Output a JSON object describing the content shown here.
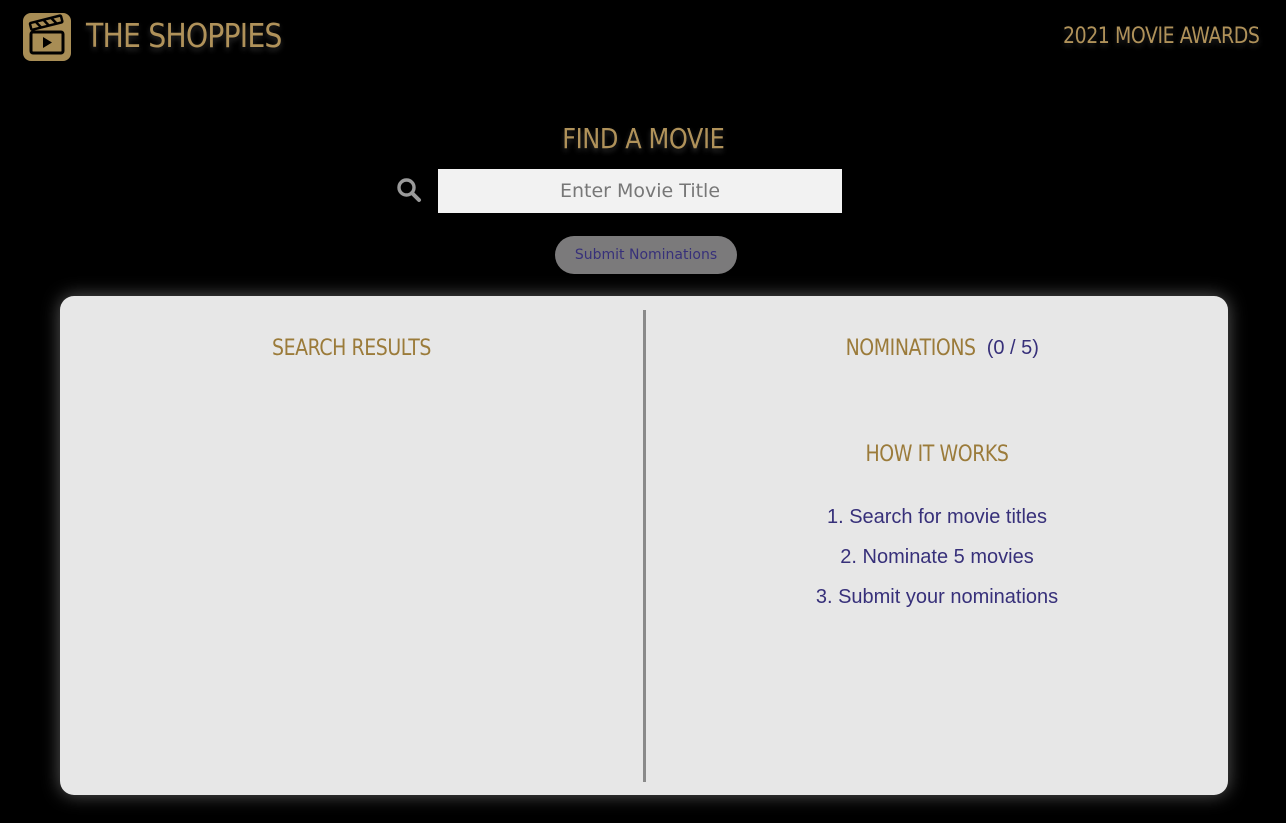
{
  "header": {
    "brand": "THE SHOPPIES",
    "logo_icon": "clapperboard-icon",
    "awards": "2021 MOVIE AWARDS"
  },
  "search": {
    "title": "FIND A MOVIE",
    "icon": "search-icon",
    "placeholder": "Enter Movie Title",
    "value": ""
  },
  "submit": {
    "label": "Submit Nominations"
  },
  "results": {
    "title": "SEARCH RESULTS",
    "items": []
  },
  "nominations": {
    "title": "NOMINATIONS",
    "count": "(0 / 5)",
    "items": []
  },
  "how_it_works": {
    "title": "HOW IT WORKS",
    "steps": [
      "1. Search for movie titles",
      "2. Nominate 5 movies",
      "3. Submit your nominations"
    ]
  },
  "colors": {
    "background": "#000000",
    "gold": "#b0925a",
    "panel": "#e7e7e7",
    "text_purple": "#37307a"
  }
}
